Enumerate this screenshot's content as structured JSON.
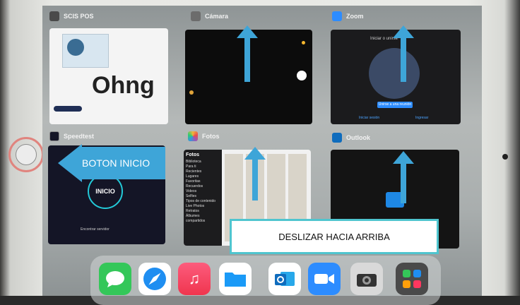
{
  "apps": {
    "scis": {
      "title": "SCIS POS",
      "logo_text": "Ohng"
    },
    "camera": {
      "title": "Cámara"
    },
    "zoom": {
      "title": "Zoom",
      "welcome": "Iniciar o unirse",
      "join_button": "Unirse a una reunión",
      "footer_left": "Iniciar sesión",
      "footer_right": "Ingresar"
    },
    "speedtest": {
      "title": "Speedtest",
      "go_label": "INICIO",
      "footer": "Encontrar servidor"
    },
    "photos": {
      "title": "Fotos",
      "sidebar_title": "Fotos",
      "sidebar_items": [
        "Biblioteca",
        "Para ti",
        "Recientes",
        "Lugares",
        "Favoritas",
        "Recuerdos",
        "Videos",
        "Selfies",
        "Tipos de contenido",
        "Live Photos",
        "Retratos",
        "Álbumes compartidos"
      ]
    },
    "outlook": {
      "title": "Outlook"
    }
  },
  "annotations": {
    "home_label": "BOTON INICIO",
    "swipe_label": "DESLIZAR HACIA ARRIBA"
  },
  "dock": {
    "icons": [
      "messages-icon",
      "safari-icon",
      "music-icon",
      "files-icon",
      "outlook-icon",
      "zoom-icon",
      "camera-icon",
      "app-library-icon"
    ]
  },
  "colors": {
    "arrow": "#3ea5d8",
    "callout_border": "#4fc5cf",
    "home_ring": "#e0847e"
  }
}
